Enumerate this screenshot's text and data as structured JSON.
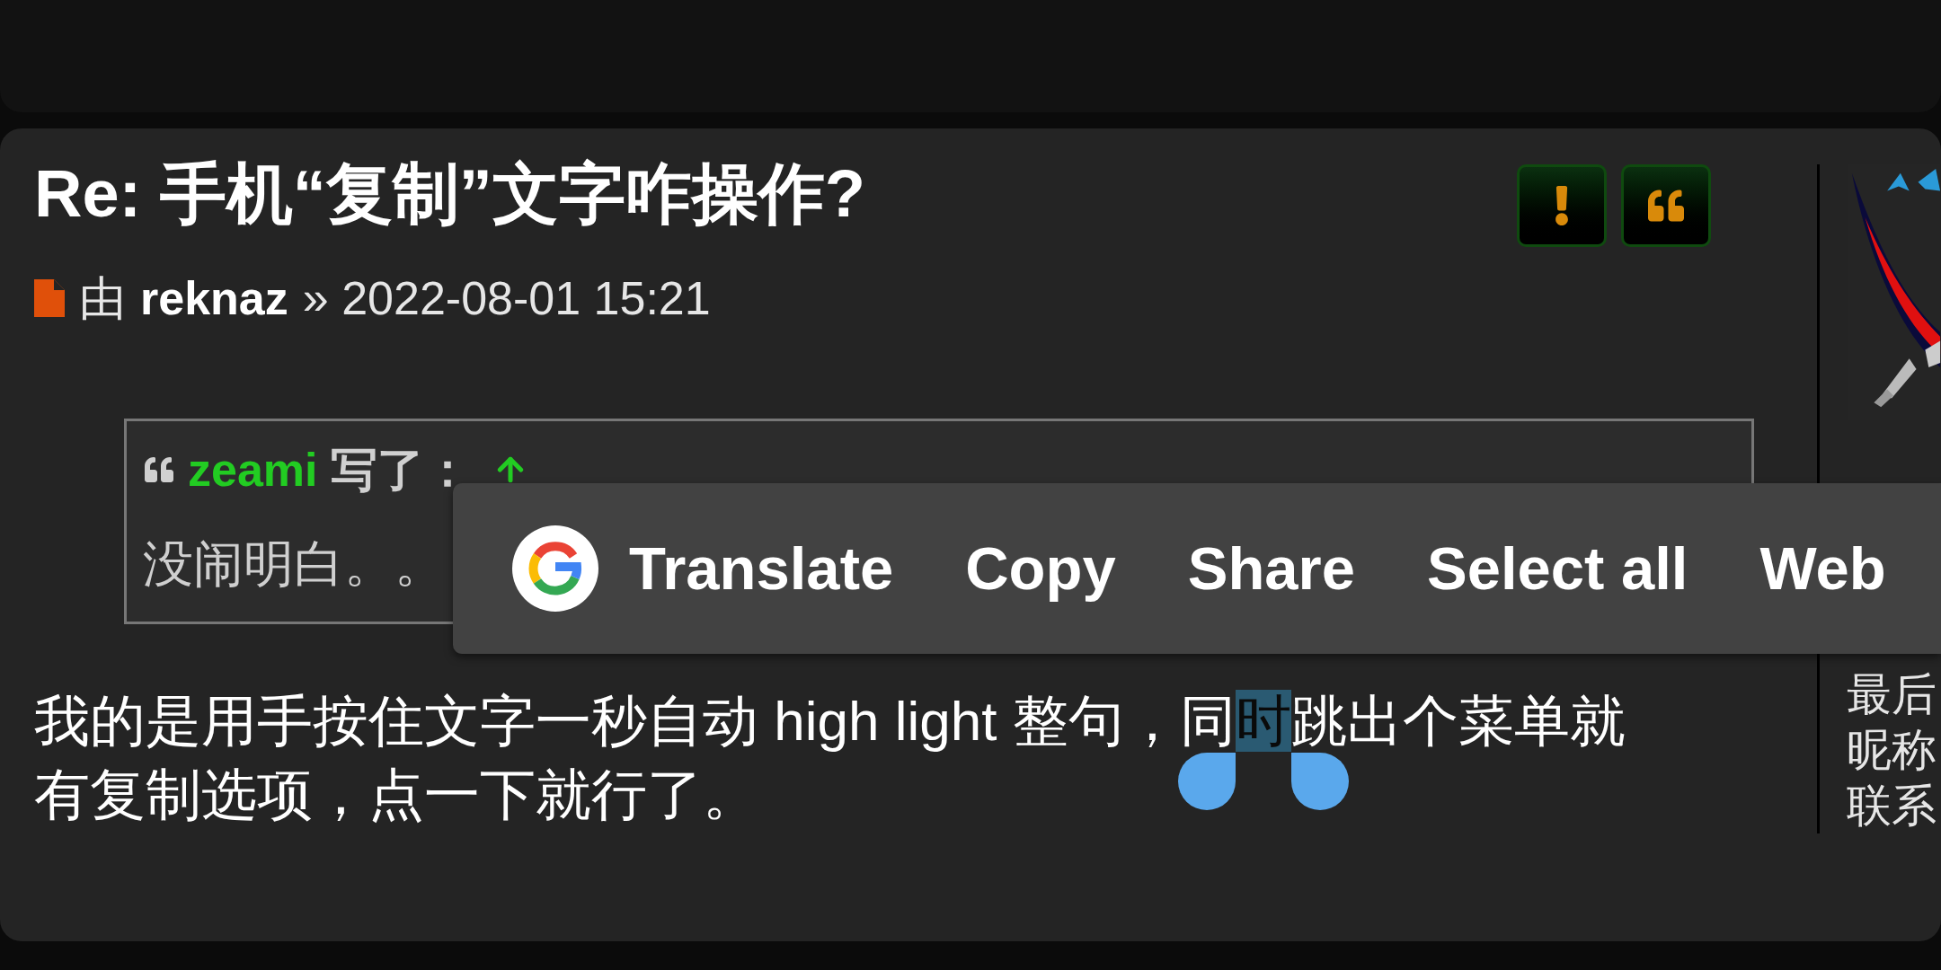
{
  "post": {
    "title": "Re: 手机“复制”文字咋操作?",
    "meta": {
      "prefix": "由",
      "author": "reknaz",
      "separator": "»",
      "date": "2022-08-01 15:21"
    },
    "actions": [
      {
        "kind": "report"
      },
      {
        "kind": "quote"
      }
    ],
    "quote": {
      "author": "zeami",
      "wrote": "写了：",
      "text": "没闹明白。。"
    },
    "body": {
      "lines": [
        [
          {
            "text": "我的是用手按住文字一秒自动 high light 整句，同",
            "selected": false
          },
          {
            "text": "时",
            "selected": true
          },
          {
            "text": "跳出个菜单就",
            "selected": false
          }
        ],
        [
          {
            "text": "有复制选项，点一下就行了。",
            "selected": false
          }
        ]
      ]
    },
    "sidebar": {
      "lines": [
        "最后",
        "昵称",
        "联系"
      ]
    }
  },
  "context_menu": {
    "items": [
      {
        "kind": "translate",
        "label": "Translate"
      },
      {
        "kind": "plain",
        "label": "Copy"
      },
      {
        "kind": "plain",
        "label": "Share"
      },
      {
        "kind": "plain",
        "label": "Select all"
      },
      {
        "kind": "plain",
        "label": "Web"
      }
    ]
  }
}
